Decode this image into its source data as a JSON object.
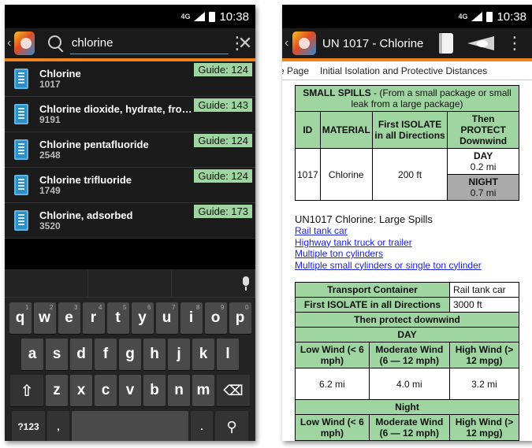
{
  "left": {
    "status": {
      "network": "4G",
      "time": "10:38"
    },
    "search": {
      "value": "chlorine",
      "clear_glyph": "✕",
      "overflow_glyph": "⋮",
      "back_glyph": "‹"
    },
    "results": [
      {
        "name": "Chlorine",
        "id": "1017",
        "guide": "Guide: 124"
      },
      {
        "name": "Chlorine dioxide, hydrate, fro…",
        "id": "9191",
        "guide": "Guide: 143"
      },
      {
        "name": "Chlorine pentafluoride",
        "id": "2548",
        "guide": "Guide: 124"
      },
      {
        "name": "Chlorine trifluoride",
        "id": "1749",
        "guide": "Guide: 124"
      },
      {
        "name": "Chlorine, adsorbed",
        "id": "3520",
        "guide": "Guide: 173"
      }
    ],
    "keyboard": {
      "row1": [
        "q",
        "w",
        "e",
        "r",
        "t",
        "y",
        "u",
        "i",
        "o",
        "p"
      ],
      "row1_sup": [
        "1",
        "2",
        "3",
        "4",
        "5",
        "6",
        "7",
        "8",
        "9",
        "0"
      ],
      "row2": [
        "a",
        "s",
        "d",
        "f",
        "g",
        "h",
        "j",
        "k",
        "l"
      ],
      "row3": [
        "z",
        "x",
        "c",
        "v",
        "b",
        "n",
        "m"
      ],
      "shift": "⇧",
      "backspace": "⌫",
      "symbols": "?123",
      "comma": ",",
      "period": ".",
      "search_key": "⚲"
    }
  },
  "right": {
    "status": {
      "network": "4G",
      "time": "10:38"
    },
    "title": "UN 1017 - Chlorine",
    "back_glyph": "‹",
    "overflow_glyph": "⋮",
    "tabs": {
      "prev": "e Page",
      "active": "Initial Isolation and Protective Distances"
    },
    "small_spills": {
      "header_bold": "SMALL SPILLS",
      "header_rest": " - (From a small package or small leak from a large package)",
      "col_id": "ID",
      "col_material": "MATERIAL",
      "col_isolate": "First ISOLATE in all Directions",
      "col_protect": "Then PROTECT Downwind",
      "id": "1017",
      "material": "Chlorine",
      "isolate": "200 ft",
      "day_label": "DAY",
      "day_value": "0.2 mi",
      "night_label": "NIGHT",
      "night_value": "0.7 mi"
    },
    "large_spills": {
      "title": "UN1017 Chlorine: Large Spills",
      "links": [
        "Rail tank car",
        "Highway tank truck or trailer",
        "Multiple ton cylinders",
        "Multiple small cylinders or single ton cylinder"
      ],
      "transport_label": "Transport Container",
      "transport_value": "Rail tank car",
      "isolate_label": "First ISOLATE in all Directions",
      "isolate_value": "3000 ft",
      "protect_label": "Then protect downwind",
      "day_label": "DAY",
      "night_label": "Night",
      "low_wind": "Low Wind (< 6 mph)",
      "moderate_wind": "Moderate Wind (6 — 12 mph)",
      "high_wind": "High Wind (> 12 mpg)",
      "day_low": "6.2 mi",
      "day_moderate": "4.0 mi",
      "day_high": "3.2 mi"
    }
  }
}
